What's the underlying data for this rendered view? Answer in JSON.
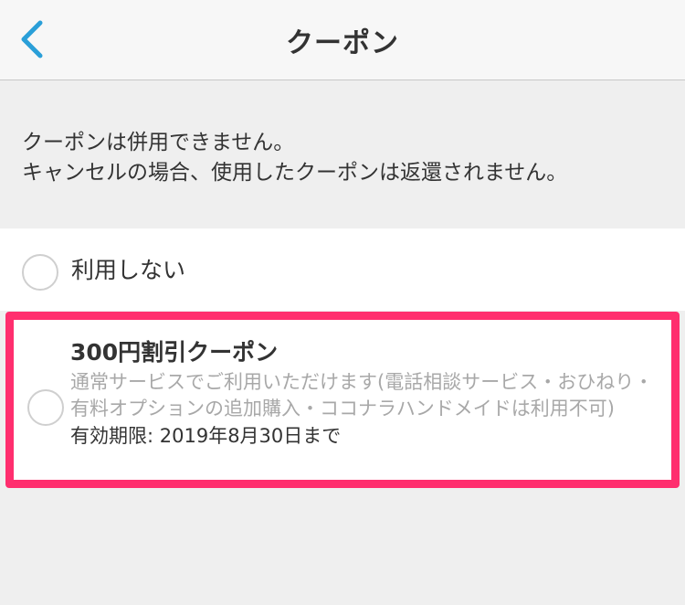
{
  "navbar": {
    "title": "クーポン",
    "back_icon": "chevron-left-icon",
    "accent_color": "#2a9fd8"
  },
  "notice": {
    "line1": "クーポンは併用できません。",
    "line2": "キャンセルの場合、使用したクーポンは返還されません。"
  },
  "options": {
    "none_label": "利用しない",
    "coupon": {
      "title": "300円割引クーポン",
      "description": "通常サービスでご利用いただけます(電話相談サービス・おひねり・有料オプションの追加購入・ココナラハンドメイドは利用不可)",
      "expiry": "有効期限: 2019年8月30日まで",
      "highlight_color": "#ff2e6e"
    }
  }
}
